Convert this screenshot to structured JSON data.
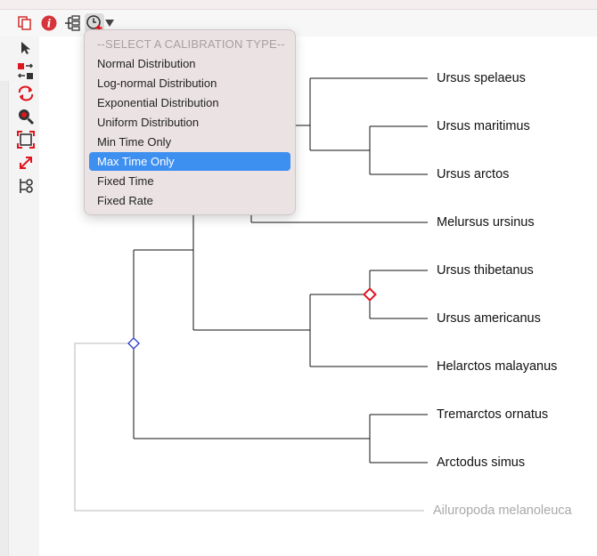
{
  "calibration_menu": {
    "header": "--SELECT A CALIBRATION TYPE--",
    "items": [
      "Normal Distribution",
      "Log-normal Distribution",
      "Exponential Distribution",
      "Uniform Distribution",
      "Min Time Only",
      "Max Time Only",
      "Fixed Time",
      "Fixed Rate"
    ],
    "selected": "Max Time Only"
  },
  "tree": {
    "leaves": [
      "Ursus spelaeus",
      "Ursus maritimus",
      "Ursus arctos",
      "Melursus ursinus",
      "Ursus thibetanus",
      "Ursus americanus",
      "Helarctos malayanus",
      "Tremarctos ornatus",
      "Arctodus simus"
    ],
    "outgroup": "Ailuropoda melanoleuca"
  },
  "icons": {
    "toolbar": [
      "copy-icon",
      "info-icon",
      "tree-layout-icon",
      "add-calibration-icon",
      "dropdown-arrow-icon"
    ],
    "sidebar": [
      "select-pointer-icon",
      "swap-nodes-icon",
      "rotate-icon",
      "zoom-icon",
      "fit-to-window-icon",
      "expand-icon",
      "tree-settings-icon"
    ]
  },
  "colors": {
    "menu_background": "#ebe3e3",
    "selected_item": "#3d8ff0",
    "calibration_node_marker": "#e0161f",
    "root_node_marker": "#2a39c8",
    "outgroup_text": "#a9a9a9"
  }
}
